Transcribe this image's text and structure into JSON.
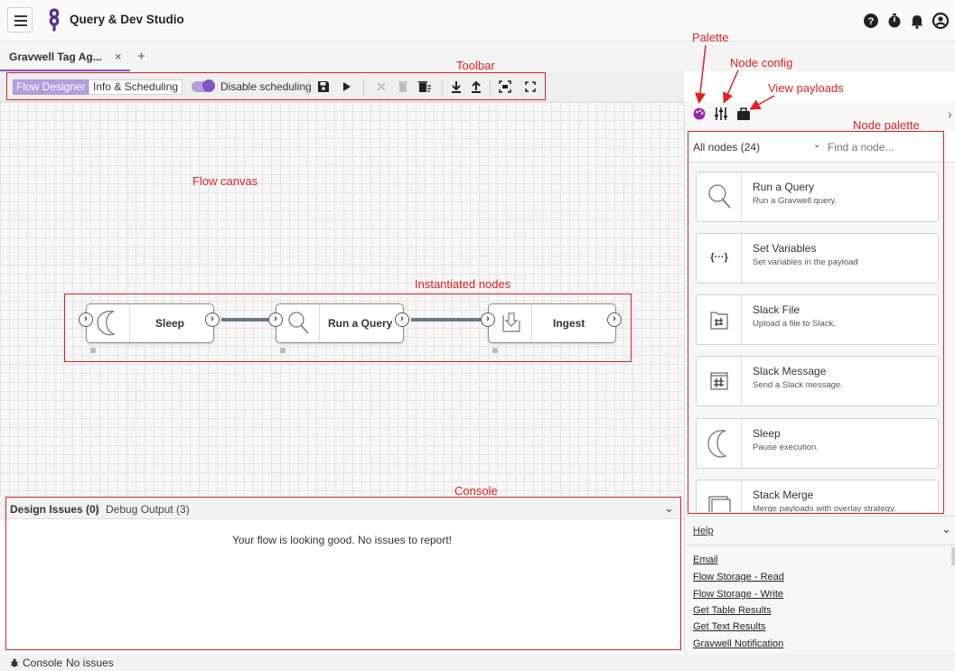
{
  "app": {
    "title": "Query & Dev Studio"
  },
  "tabs": [
    {
      "label": "Gravwell Tag Ag...",
      "close": "×"
    }
  ],
  "tab_add": "+",
  "toolbar": {
    "flow_designer": "Flow Designer",
    "info_scheduling": "Info & Scheduling",
    "disable_scheduling": "Disable scheduling",
    "scheduling_disabled": true
  },
  "annotations": {
    "palette": "Palette",
    "node_config": "Node config",
    "view_payloads": "View payloads",
    "toolbar": "Toolbar",
    "node_palette": "Node palette",
    "flow_canvas": "Flow canvas",
    "instantiated_nodes": "Instantiated nodes",
    "console": "Console"
  },
  "flow": {
    "nodes": [
      {
        "label": "Sleep",
        "icon": "moon-icon"
      },
      {
        "label": "Run a Query",
        "icon": "magnifier-icon"
      },
      {
        "label": "Ingest",
        "icon": "ingest-icon"
      }
    ]
  },
  "palette": {
    "filter": "All nodes (24)",
    "search_placeholder": "Find a node...",
    "nodes": [
      {
        "title": "Run a Query",
        "desc": "Run a Gravwell query.",
        "icon": "magnifier-icon"
      },
      {
        "title": "Set Variables",
        "desc": "Set variables in the payload",
        "icon": "braces-icon",
        "glyph": "{···}"
      },
      {
        "title": "Slack File",
        "desc": "Upload a file to Slack.",
        "icon": "slack-file-icon"
      },
      {
        "title": "Slack Message",
        "desc": "Send a Slack message.",
        "icon": "slack-message-icon"
      },
      {
        "title": "Sleep",
        "desc": "Pause execution.",
        "icon": "moon-icon"
      },
      {
        "title": "Stack Merge",
        "desc": "Merge payloads with overlay strategy.",
        "icon": "stack-icon"
      }
    ]
  },
  "help": {
    "title": "Help",
    "links": [
      "Email",
      "Flow Storage - Read",
      "Flow Storage - Write",
      "Get Table Results",
      "Get Text Results",
      "Gravwell Notification"
    ]
  },
  "console": {
    "tab_design": "Design Issues (0)",
    "divider": "|",
    "tab_debug": "Debug Output (3)",
    "message": "Your flow is looking good. No issues to report!"
  },
  "statusbar": {
    "console_label": "Console",
    "status": "No issues"
  },
  "colors": {
    "accent": "#7e57c2",
    "accent_light": "#b39ddb",
    "annotation": "#e02020"
  }
}
